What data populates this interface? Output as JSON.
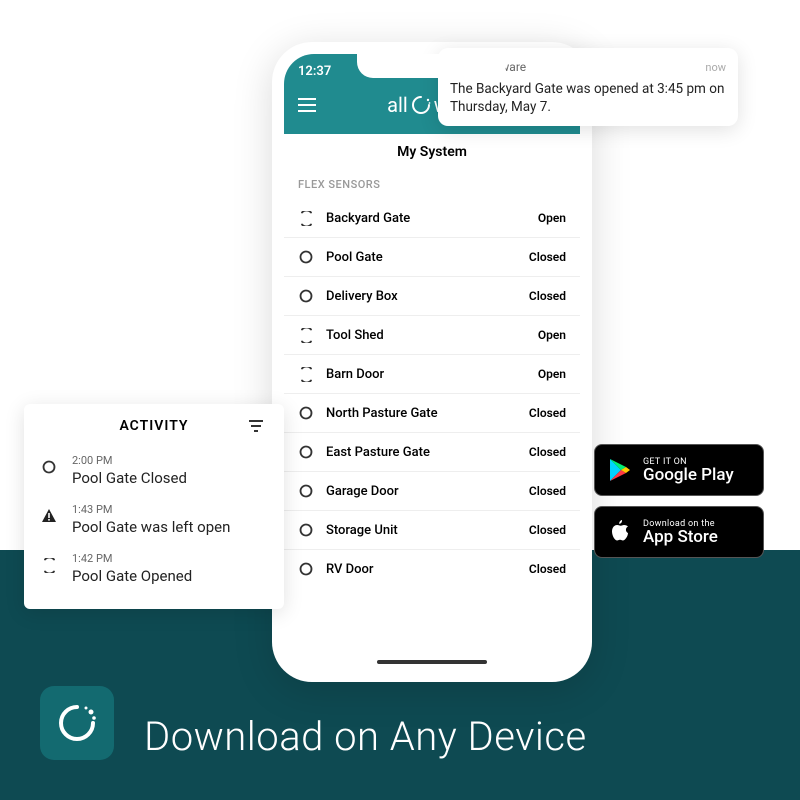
{
  "banner": {
    "text": "Download on Any Device"
  },
  "phone": {
    "time": "12:37",
    "logo_text": "all aware",
    "title": "My System",
    "section": "FLEX SENSORS",
    "sensors": [
      {
        "name": "Backyard Gate",
        "status": "Open",
        "open": true
      },
      {
        "name": "Pool Gate",
        "status": "Closed",
        "open": false
      },
      {
        "name": "Delivery Box",
        "status": "Closed",
        "open": false
      },
      {
        "name": "Tool Shed",
        "status": "Open",
        "open": true
      },
      {
        "name": "Barn Door",
        "status": "Open",
        "open": true
      },
      {
        "name": "North Pasture Gate",
        "status": "Closed",
        "open": false
      },
      {
        "name": "East Pasture Gate",
        "status": "Closed",
        "open": false
      },
      {
        "name": "Garage Door",
        "status": "Closed",
        "open": false
      },
      {
        "name": "Storage Unit",
        "status": "Closed",
        "open": false
      },
      {
        "name": "RV Door",
        "status": "Closed",
        "open": false
      }
    ]
  },
  "notification": {
    "app": "All Aware",
    "when": "now",
    "body": "The Backyard Gate was opened at 3:45 pm on Thursday, May 7."
  },
  "activity": {
    "title": "ACTIVITY",
    "items": [
      {
        "time": "2:00 PM",
        "text": "Pool Gate Closed",
        "icon": "closed"
      },
      {
        "time": "1:43 PM",
        "text": "Pool Gate was left open",
        "icon": "warn"
      },
      {
        "time": "1:42 PM",
        "text": "Pool Gate Opened",
        "icon": "open"
      }
    ]
  },
  "stores": {
    "google": {
      "small": "GET IT ON",
      "big": "Google Play"
    },
    "apple": {
      "small": "Download on the",
      "big": "App Store"
    }
  }
}
